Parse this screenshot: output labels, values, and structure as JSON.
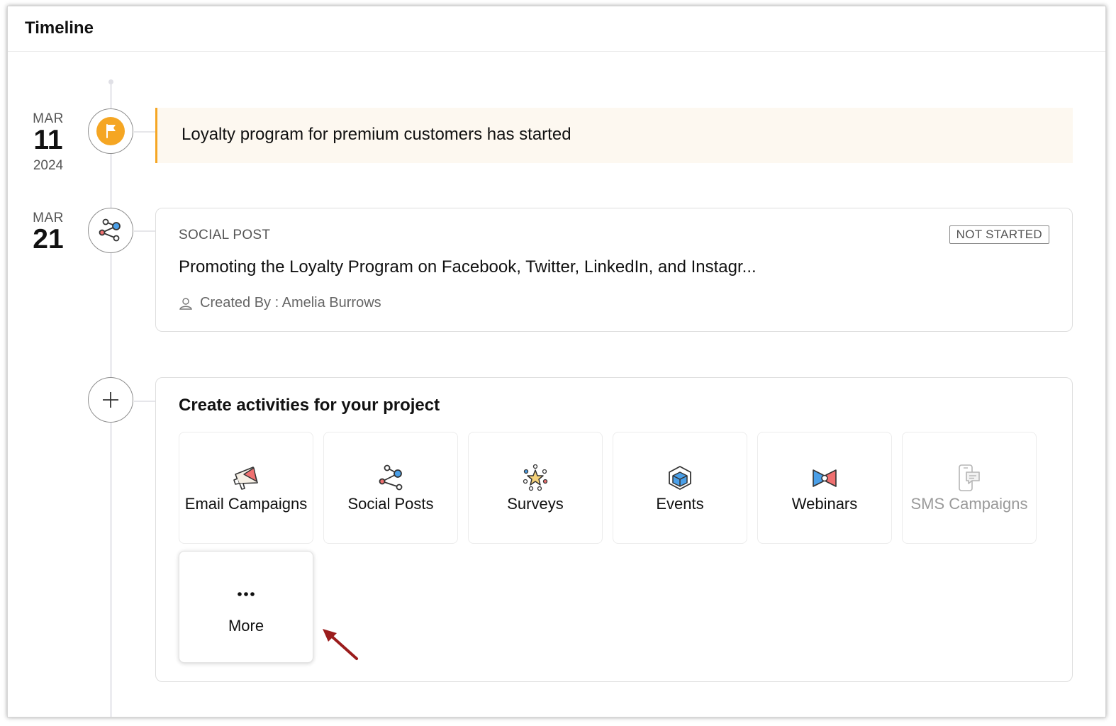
{
  "header": {
    "title": "Timeline"
  },
  "timeline": [
    {
      "kind": "milestone",
      "date": {
        "month": "MAR",
        "day": "11",
        "year": "2024"
      },
      "icon": "flag-icon",
      "text": "Loyalty program for premium customers has started",
      "accent": "#f5a623"
    },
    {
      "kind": "activity",
      "date": {
        "month": "MAR",
        "day": "21"
      },
      "icon": "share-icon",
      "type": "SOCIAL POST",
      "status": "NOT STARTED",
      "title": "Promoting the Loyalty Program on Facebook, Twitter, LinkedIn, and Instagr...",
      "created_by": "Created By : Amelia Burrows"
    }
  ],
  "create": {
    "icon": "plus-icon",
    "title": "Create activities for your project",
    "options": [
      {
        "label": "Email Campaigns",
        "icon": "megaphone-icon",
        "enabled": true
      },
      {
        "label": "Social Posts",
        "icon": "share-icon",
        "enabled": true
      },
      {
        "label": "Surveys",
        "icon": "survey-icon",
        "enabled": true
      },
      {
        "label": "Events",
        "icon": "events-icon",
        "enabled": true
      },
      {
        "label": "Webinars",
        "icon": "webinar-icon",
        "enabled": true
      },
      {
        "label": "SMS Campaigns",
        "icon": "sms-icon",
        "enabled": false
      },
      {
        "label": "More",
        "icon": "more-icon",
        "enabled": true
      }
    ]
  },
  "colors": {
    "milestone_accent": "#f5a623",
    "milestone_bg": "#fdf8f0",
    "share_blue": "#4a9fe8",
    "annotation_arrow": "#9b1c1c"
  }
}
